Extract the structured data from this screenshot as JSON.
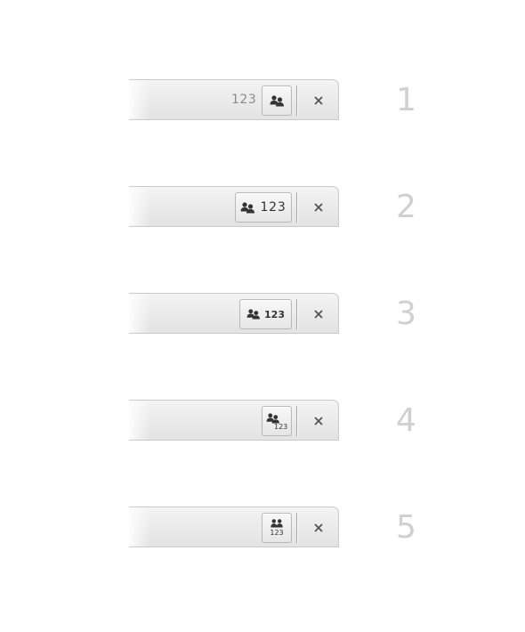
{
  "variants": [
    {
      "number": "1",
      "count": "123",
      "count_placement": "outside-left"
    },
    {
      "number": "2",
      "count": "123",
      "count_placement": "inline-right"
    },
    {
      "number": "3",
      "count": "123",
      "count_placement": "inline-right-small-bold"
    },
    {
      "number": "4",
      "count": "123",
      "count_placement": "subscript-right"
    },
    {
      "number": "5",
      "count": "123",
      "count_placement": "below-centered"
    }
  ],
  "icons": {
    "users": "users-icon",
    "close": "close-icon"
  },
  "colors": {
    "bar_top": "#f3f3f3",
    "bar_bottom": "#e3e3e3",
    "icon": "#333333",
    "row_number": "#d0d0d0",
    "muted_count": "#8c8c8c"
  }
}
